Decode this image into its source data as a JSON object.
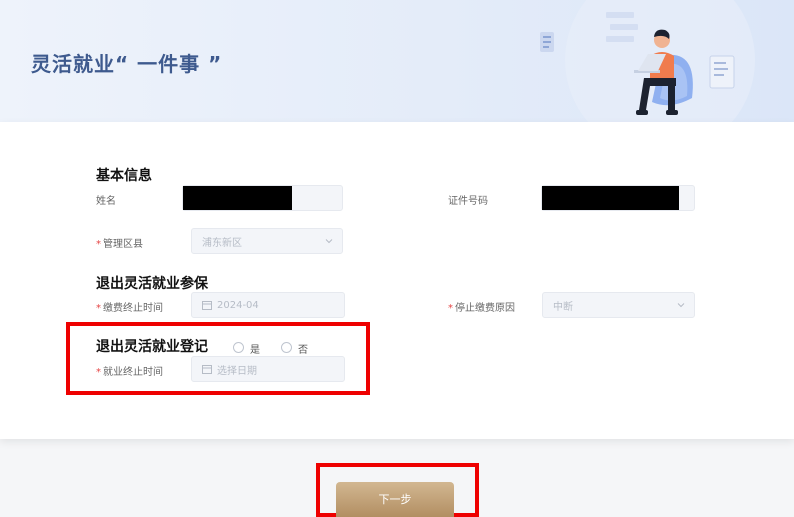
{
  "banner": {
    "title": "灵活就业“ 一件事 ”"
  },
  "section_basic": {
    "title": "基本信息",
    "name_label": "姓名",
    "id_label": "证件号码",
    "district_label": "管理区县",
    "district_value": "浦东新区"
  },
  "section_insurance": {
    "title": "退出灵活就业参保",
    "pay_end_label": "缴费终止时间",
    "pay_end_value": "2024-04",
    "stop_reason_label": "停止缴费原因",
    "stop_reason_value": "中断"
  },
  "section_registration": {
    "title": "退出灵活就业登记",
    "radio_yes": "是",
    "radio_no": "否",
    "employment_end_label": "就业终止时间",
    "employment_end_placeholder": "选择日期"
  },
  "footer": {
    "next_label": "下一步"
  },
  "required_mark": "*",
  "colors": {
    "title_blue": "#3e5a8e",
    "required_red": "#e54545",
    "highlight_red": "#ee0000",
    "button_gold": "#c4a67c"
  }
}
